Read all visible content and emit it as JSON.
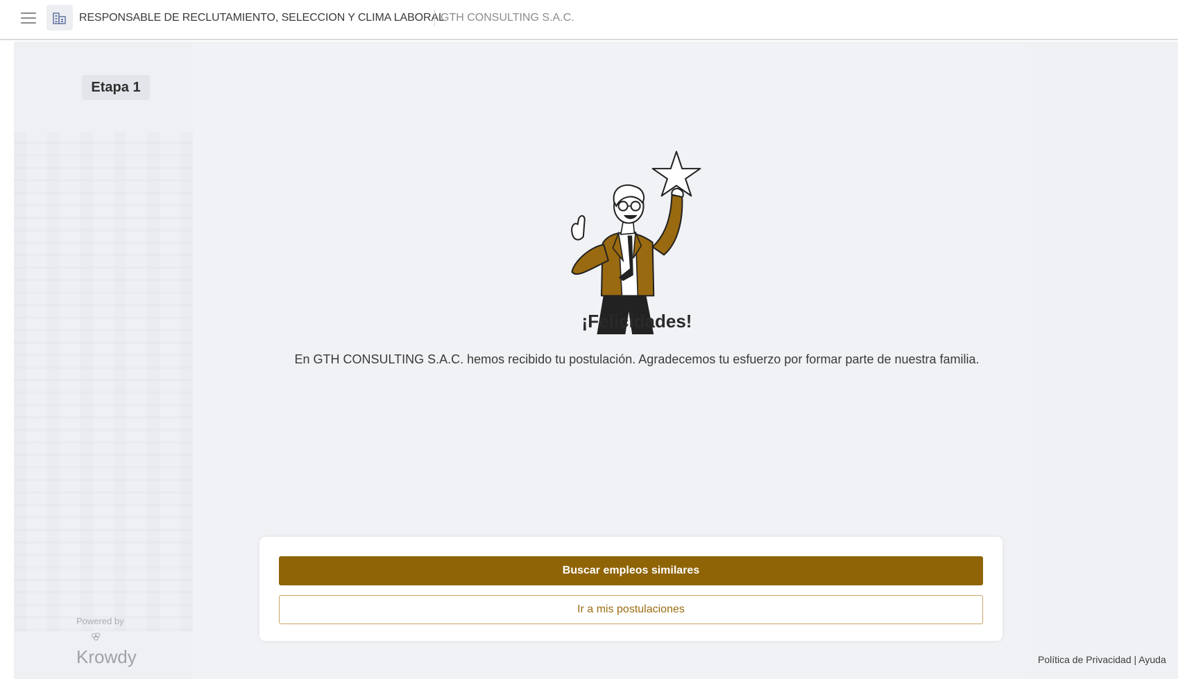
{
  "header": {
    "job_title": "RESPONSABLE DE RECLUTAMIENTO, SELECCION Y CLIMA LABORAL",
    "company_name": "GTH CONSULTING S.A.C."
  },
  "sidebar": {
    "stage_label": "Etapa 1",
    "powered_by": "Powered by",
    "brand": "Krowdy"
  },
  "main": {
    "heading": "¡Felicidades!",
    "message": "En GTH CONSULTING S.A.C. hemos recibido tu postulación. Agradecemos tu esfuerzo por formar parte de nuestra familia."
  },
  "actions": {
    "primary_label": "Buscar empleos similares",
    "secondary_label": "Ir a mis postulaciones"
  },
  "footer": {
    "privacy_label": "Política de Privacidad",
    "separator": "|",
    "help_label": "Ayuda"
  },
  "colors": {
    "accent": "#8f6406",
    "jacket": "#9a6a10",
    "outline_border": "#c9a466"
  },
  "icons": {
    "menu": "hamburger-menu-icon",
    "company": "building-icon",
    "illustration": "man-holding-star-illustration"
  }
}
